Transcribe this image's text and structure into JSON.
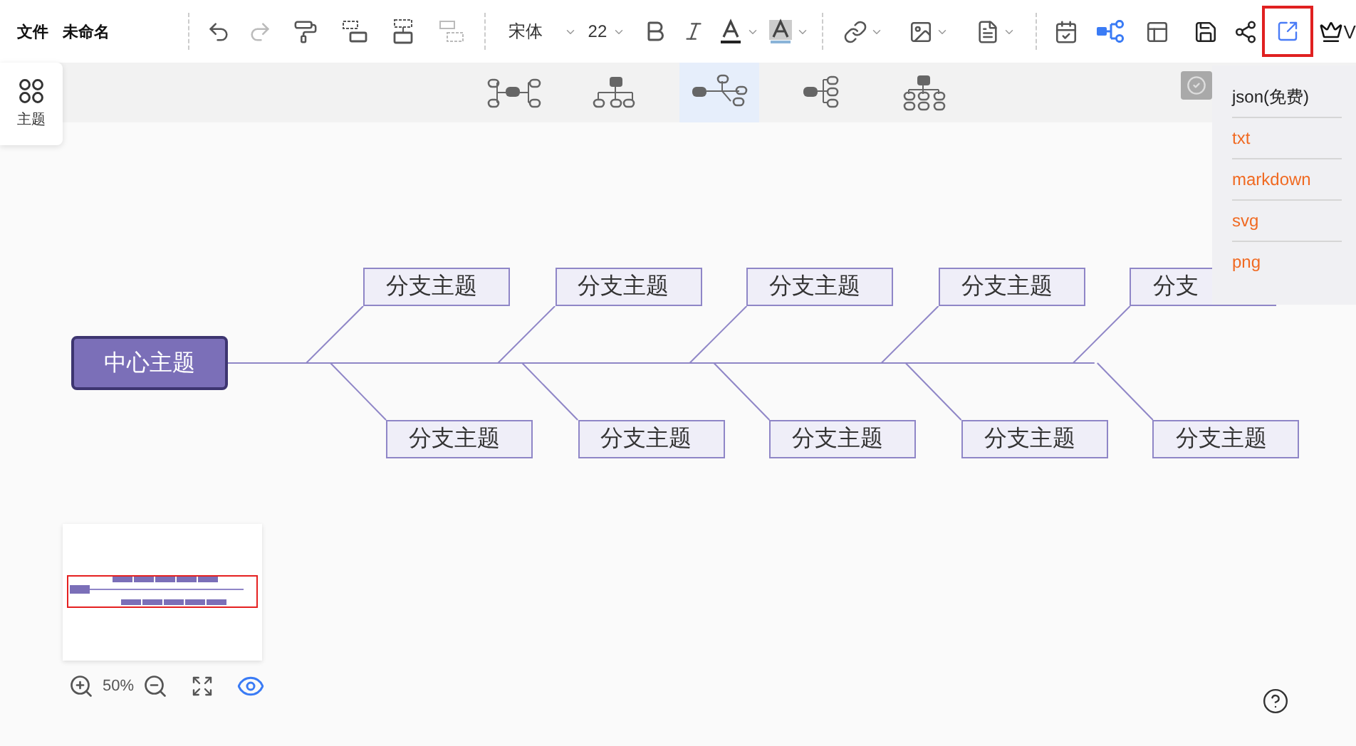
{
  "toolbar": {
    "file_menu": "文件",
    "doc_title": "未命名",
    "font": "宋体",
    "font_size": "22",
    "vip_label": "V",
    "export_active": true
  },
  "theme_panel": {
    "label": "主题"
  },
  "layouts": [
    {
      "kind": "mindmap",
      "selected": false
    },
    {
      "kind": "org",
      "selected": false
    },
    {
      "kind": "fishbone",
      "selected": true
    },
    {
      "kind": "logic",
      "selected": false
    },
    {
      "kind": "tree",
      "selected": false
    }
  ],
  "diagram": {
    "center": "中心主题",
    "top_branches": [
      "分支主题",
      "分支主题",
      "分支主题",
      "分支主题",
      "分支"
    ],
    "bottom_branches": [
      "分支主题",
      "分支主题",
      "分支主题",
      "分支主题",
      "分支主题"
    ]
  },
  "export_menu": {
    "items": [
      {
        "label": "json(免费)",
        "kind": "free"
      },
      {
        "label": "txt",
        "kind": "paid"
      },
      {
        "label": "markdown",
        "kind": "paid"
      },
      {
        "label": "svg",
        "kind": "paid"
      },
      {
        "label": "png",
        "kind": "paid"
      }
    ]
  },
  "zoom": {
    "level": "50%"
  }
}
